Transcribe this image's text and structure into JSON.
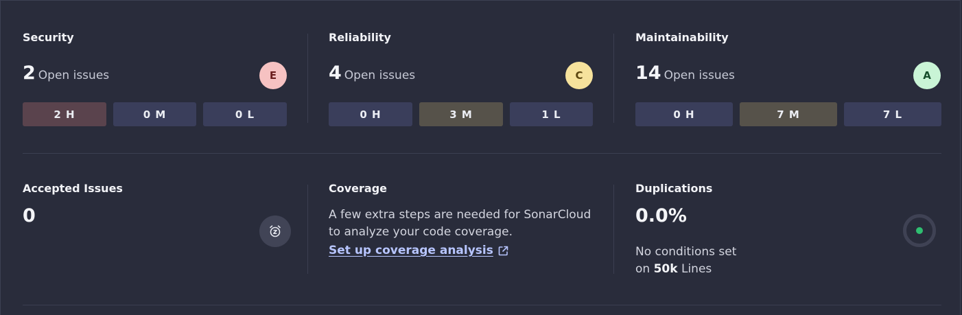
{
  "security": {
    "title": "Security",
    "count": "2",
    "count_suffix": "Open issues",
    "grade": "E",
    "grade_color": "#f6c2c2",
    "grade_text_color": "#6b1d1d",
    "high": "2 H",
    "medium": "0 M",
    "low": "0 L"
  },
  "reliability": {
    "title": "Reliability",
    "count": "4",
    "count_suffix": "Open issues",
    "grade": "C",
    "grade_color": "#f6e29c",
    "grade_text_color": "#5b4610",
    "high": "0 H",
    "medium": "3 M",
    "low": "1 L"
  },
  "maintainability": {
    "title": "Maintainability",
    "count": "14",
    "count_suffix": "Open issues",
    "grade": "A",
    "grade_color": "#c9f4d6",
    "grade_text_color": "#154d2b",
    "high": "0 H",
    "medium": "7 M",
    "low": "7 L"
  },
  "accepted": {
    "title": "Accepted Issues",
    "count": "0",
    "icon": "snooze-clock-icon"
  },
  "coverage": {
    "title": "Coverage",
    "desc_line1": "A few extra steps are needed for SonarCloud",
    "desc_line2": "to analyze your code coverage.",
    "link": "Set up coverage analysis",
    "link_icon": "external-link-icon"
  },
  "duplications": {
    "title": "Duplications",
    "value": "0.0%",
    "note_line1": "No conditions set",
    "note_prefix": "on",
    "lines_bold": "50k",
    "lines_suffix": "Lines",
    "status_color": "#2fbf71"
  }
}
